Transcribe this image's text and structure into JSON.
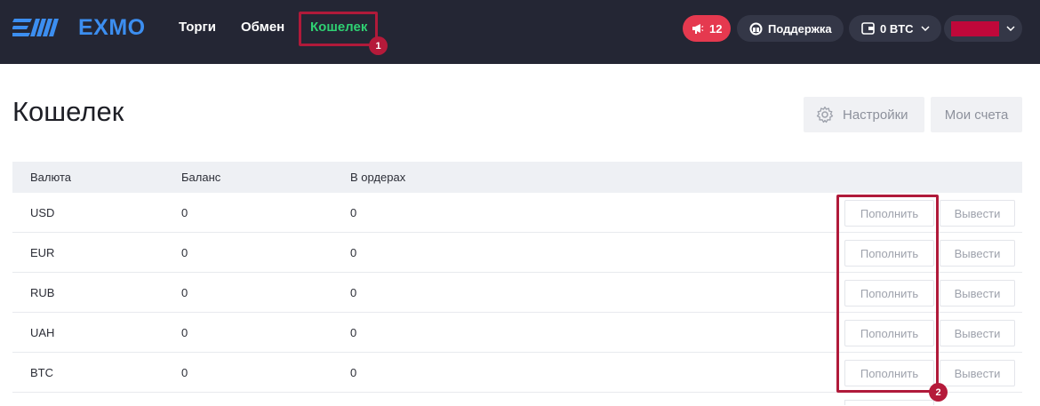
{
  "header": {
    "brand": "EXMO",
    "nav": [
      {
        "label": "Торги"
      },
      {
        "label": "Обмен"
      },
      {
        "label": "Кошелек"
      }
    ],
    "notifications_count": "12",
    "support_label": "Поддержка",
    "balance_label": "0 BTC"
  },
  "annotations": [
    {
      "label": "1"
    },
    {
      "label": "2"
    }
  ],
  "main": {
    "title": "Кошелек",
    "settings_label": "Настройки",
    "accounts_label": "Мои счета"
  },
  "table": {
    "headers": [
      "Валюта",
      "Баланс",
      "В ордерах"
    ],
    "rows": [
      {
        "currency": "USD",
        "balance": "0",
        "in_orders": "0",
        "deposit": "Пополнить",
        "withdraw": "Вывести"
      },
      {
        "currency": "EUR",
        "balance": "0",
        "in_orders": "0",
        "deposit": "Пополнить",
        "withdraw": "Вывести"
      },
      {
        "currency": "RUB",
        "balance": "0",
        "in_orders": "0",
        "deposit": "Пополнить",
        "withdraw": "Вывести"
      },
      {
        "currency": "UAH",
        "balance": "0",
        "in_orders": "0",
        "deposit": "Пополнить",
        "withdraw": "Вывести"
      },
      {
        "currency": "BTC",
        "balance": "0",
        "in_orders": "0",
        "deposit": "Пополнить",
        "withdraw": "Вывести"
      }
    ]
  },
  "icons": [
    "exmo-logo-icon",
    "megaphone-icon",
    "support-icon",
    "wallet-icon",
    "chevron-down-icon",
    "gear-icon"
  ],
  "colors": {
    "topbar": "#242634",
    "brand_blue": "#3c8ef0",
    "active_nav": "#2fd173",
    "notif": "#e5394f",
    "annotation": "#b01a3a"
  }
}
